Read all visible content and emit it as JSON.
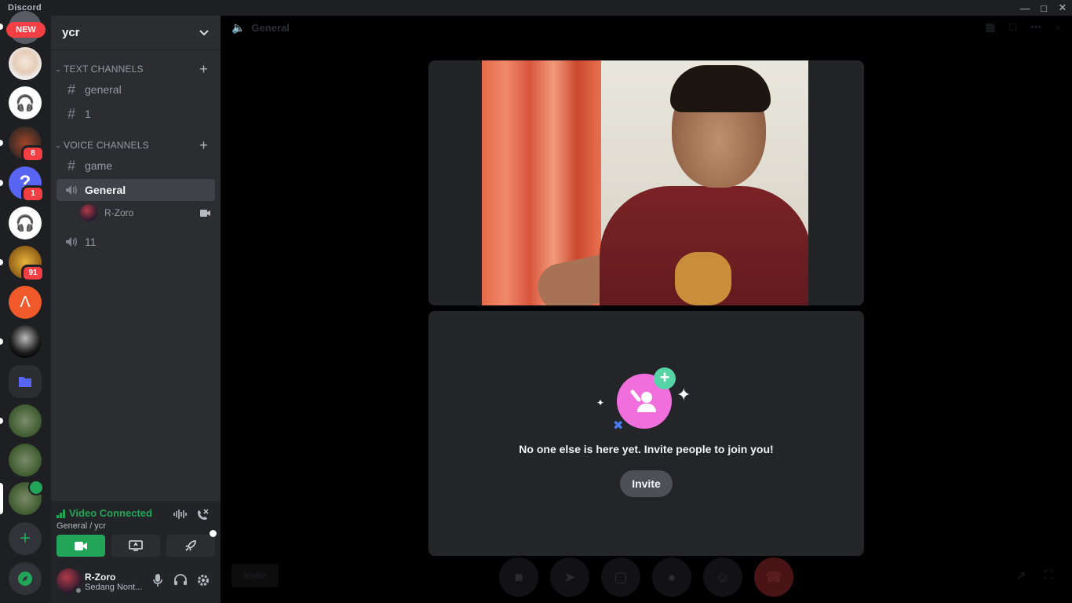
{
  "window": {
    "title": "Discord"
  },
  "rail": {
    "new_badge": "NEW",
    "badges": {
      "server3": "8",
      "server4": "1",
      "server6": "91"
    }
  },
  "guild": {
    "name": "ycr"
  },
  "channels": {
    "text_category": "TEXT CHANNELS",
    "text": [
      {
        "name": "general"
      },
      {
        "name": "1"
      }
    ],
    "voice_category": "VOICE CHANNELS",
    "voice": [
      {
        "name": "game"
      },
      {
        "name": "General"
      },
      {
        "name": "11"
      }
    ],
    "voice_member": "R-Zoro"
  },
  "voice_panel": {
    "status": "Video Connected",
    "location": "General / ycr"
  },
  "user": {
    "name": "R-Zoro",
    "status": "Sedang Nont..."
  },
  "stage": {
    "channel": "General",
    "empty_message": "No one else is here yet. Invite people to join you!",
    "invite_label": "Invite",
    "faded_invite_label": "Invite"
  },
  "colors": {
    "accent_green": "#23a559",
    "danger": "#f23f43",
    "invite_pink": "#f06fdc",
    "invite_plus": "#57d4a5"
  },
  "icons": [
    "speaker-icon",
    "hash-icon",
    "plus-icon",
    "chevron-down-icon",
    "camera-icon",
    "signal-bars-icon",
    "soundwave-icon",
    "disconnect-icon",
    "screen-share-icon",
    "rocket-icon",
    "mic-icon",
    "headphones-icon",
    "gear-icon",
    "folder-icon",
    "compass-icon",
    "emoji-icon",
    "hangup-icon",
    "popout-icon",
    "fullscreen-icon"
  ]
}
